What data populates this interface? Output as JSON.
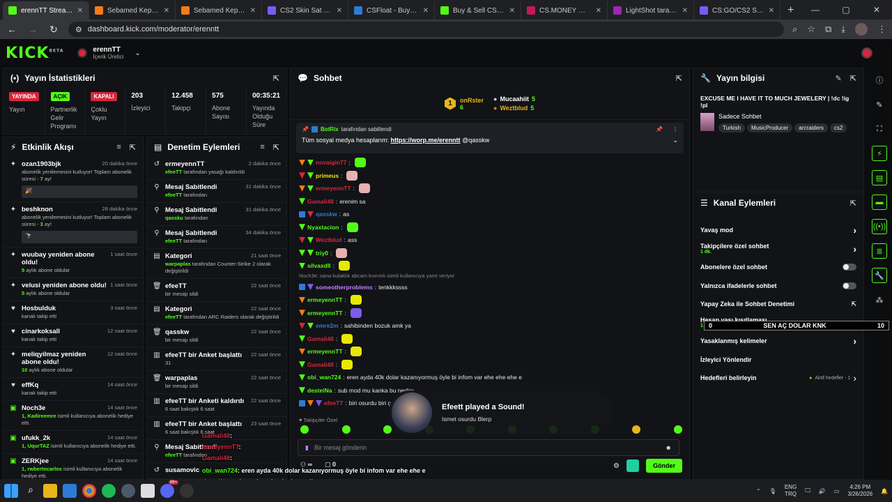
{
  "browser": {
    "tabs": [
      {
        "title": "erennTT Stream - Kick",
        "color": "#53fc18",
        "active": true
      },
      {
        "title": "Sebamed Kepek Karşıtı",
        "color": "#f57c18",
        "active": false
      },
      {
        "title": "Sebamed Kepeğe Karşı",
        "color": "#f57c18",
        "active": false
      },
      {
        "title": "CS2 Skin Sat - Anında",
        "color": "#7a5cf0",
        "active": false
      },
      {
        "title": "CSFloat - Buy & Sell C",
        "color": "#2e7bd6",
        "active": false
      },
      {
        "title": "Buy & Sell CSGO Skin",
        "color": "#53fc18",
        "active": false
      },
      {
        "title": "CS.MONEY — CS:GO",
        "color": "#c2185b",
        "active": false
      },
      {
        "title": "LightShot tarafından",
        "color": "#9c27b0",
        "active": false
      },
      {
        "title": "CS:GO/CS2 Skin Satış",
        "color": "#7a5cf0",
        "active": false
      }
    ],
    "url": "dashboard.kick.com/moderator/erenntt"
  },
  "header": {
    "logo": "KICK",
    "logo_sup": "BETA",
    "channel_name": "erennTT",
    "channel_role": "İçerik Üretici"
  },
  "stats": {
    "title": "Yayın İstatistikleri",
    "items": [
      {
        "badge": "YAYINDA",
        "badge_type": "red",
        "label": "Yayın"
      },
      {
        "badge": "AÇIK",
        "badge_type": "green",
        "label": "Partnerlik Gelir Programı"
      },
      {
        "badge": "KAPALI",
        "badge_type": "red",
        "label": "Çoklu Yayın"
      },
      {
        "num": "203",
        "label": "İzleyici"
      },
      {
        "num": "12.458",
        "label": "Takipçi"
      },
      {
        "num": "575",
        "label": "Abone Sayısı"
      },
      {
        "num": "00:35:21",
        "label": "Yayında Olduğu Süre"
      }
    ]
  },
  "activity": {
    "title": "Etkinlik Akışı",
    "items": [
      {
        "icon": "✦",
        "name": "ozan1903bjk",
        "time": "20 dakika önce",
        "sub": "abonelik yenilemesini kutluyor! Toplam abonelik süresi - ",
        "hl": "7",
        "sub2": " ay!",
        "box": "🎉"
      },
      {
        "icon": "✦",
        "name": "beshknon",
        "time": "28 dakika önce",
        "sub": "abonelik yenilemesini kutluyor! Toplam abonelik süresi - ",
        "hl": "3",
        "sub2": " ay!",
        "box": "🔭"
      },
      {
        "icon": "✦",
        "name": "wuubay yeniden abone oldu!",
        "time": "1 saat önce",
        "sub": "",
        "hl": "5",
        "sub2": " aylık abone oldular"
      },
      {
        "icon": "✦",
        "name": "velusi yeniden abone oldu!",
        "time": "1 saat önce",
        "sub": "",
        "hl": "5",
        "sub2": " aylık abone oldular"
      },
      {
        "icon": "♥",
        "name": "Hosbulduk",
        "time": "3 saat önce",
        "sub": "kanalı takip etti",
        "hl": "",
        "sub2": ""
      },
      {
        "icon": "♥",
        "name": "cinarkoksall",
        "time": "12 saat önce",
        "sub": "kanalı takip etti",
        "hl": "",
        "sub2": ""
      },
      {
        "icon": "✦",
        "name": "meliqyilmaz yeniden abone oldu!",
        "time": "12 saat önce",
        "sub": "",
        "hl": "10",
        "sub2": " aylık abone oldular"
      },
      {
        "icon": "♥",
        "name": "effKq",
        "time": "14 saat önce",
        "sub": "kanalı takip etti",
        "hl": "",
        "sub2": ""
      },
      {
        "icon": "▣",
        "name": "Noch3e",
        "time": "14 saat önce",
        "sub": "",
        "hl": "1, Kadireemre",
        "sub2": " isimli kullanıcıya abonelik hediye etti."
      },
      {
        "icon": "▣",
        "name": "ufukk_2k",
        "time": "14 saat önce",
        "sub": "",
        "hl": "1, UqurTAZ",
        "sub2": " isimli kullanıcıya abonelik hediye etti."
      },
      {
        "icon": "▣",
        "name": "ZERKjee",
        "time": "14 saat önce",
        "sub": "",
        "hl": "1, rwbertocarlos",
        "sub2": " isimli kullanıcıya abonelik hediye etti."
      }
    ]
  },
  "moderation": {
    "title": "Denetim Eylemleri",
    "items": [
      {
        "icon": "↺",
        "name": "ermeyennTT",
        "time": "2 dakika önce",
        "hl": "efeeTT",
        "sub": " tarafından yasağı kaldırıldı"
      },
      {
        "icon": "⚲",
        "name": "Mesaj Sabitlendi",
        "time": "31 dakika önce",
        "hl": "efeeTT",
        "sub": " tarafından"
      },
      {
        "icon": "⚲",
        "name": "Mesaj Sabitlendi",
        "time": "31 dakika önce",
        "hl": "qassku",
        "sub": " tarafından"
      },
      {
        "icon": "⚲",
        "name": "Mesaj Sabitlendi",
        "time": "34 dakika önce",
        "hl": "efeeTT",
        "sub": " tarafından"
      },
      {
        "icon": "▤",
        "name": "Kategori",
        "time": "21 saat önce",
        "hl": "warpaplas",
        "sub": " tarafından Counter-Strike 2 olarak değiştirildi"
      },
      {
        "icon": "🗑",
        "name": "efeeTT",
        "time": "22 saat önce",
        "hl": "",
        "sub": "bir mesajı sildi"
      },
      {
        "icon": "▤",
        "name": "Kategori",
        "time": "22 saat önce",
        "hl": "efeeTT",
        "sub": " tarafından ARC Raiders olarak değiştirildi"
      },
      {
        "icon": "🗑",
        "name": "qasskw",
        "time": "22 saat önce",
        "hl": "",
        "sub": "bir mesajı sildi"
      },
      {
        "icon": "▥",
        "name": "efeeTT bir Anket başlattı",
        "time": "22 saat önce",
        "hl": "",
        "sub": "31"
      },
      {
        "icon": "🗑",
        "name": "warpaplas",
        "time": "22 saat önce",
        "hl": "",
        "sub": "bir mesajı sildi"
      },
      {
        "icon": "▥",
        "name": "efeeTT bir Anketi kaldırdı",
        "time": "22 saat önce",
        "hl": "",
        "sub": "6 saat bakıştık 6 saat"
      },
      {
        "icon": "▥",
        "name": "efeeTT bir Anket başlattı",
        "time": "23 saat önce",
        "hl": "",
        "sub": "6 saat bakıştık 6 saat"
      },
      {
        "icon": "⚲",
        "name": "Mesaj Sabitlendi",
        "time": "",
        "hl": "efeeTT",
        "sub": " tarafından"
      },
      {
        "icon": "↺",
        "name": "susamovic",
        "time": "",
        "hl": "",
        "sub": ""
      }
    ]
  },
  "chat": {
    "title": "Sohbet",
    "top1": {
      "rank": "1",
      "name": "onRster",
      "count": "6"
    },
    "top2": {
      "name": "Mucaahiit",
      "count": "5"
    },
    "top3": {
      "name": "Weztblud",
      "count": "5"
    },
    "pinned_by": "BotRix",
    "pinned_suffix": "tarafından sabitlendi",
    "pinned_text": "Tüm sosyal medya hesaplarım: ",
    "pinned_link": "https://worp.me/erenntt",
    "pinned_mention": " @qasskw",
    "messages": [
      {
        "badges": [
          "o",
          "g"
        ],
        "nick": "novaigin77",
        "color": "#d7263d",
        "text": "",
        "emo": "#53fc18"
      },
      {
        "badges": [
          "r",
          "g"
        ],
        "nick": "primeus",
        "color": "#e8e800",
        "text": "",
        "emo": "#e8b1b1"
      },
      {
        "badges": [
          "o",
          "g"
        ],
        "nick": "ermeyennTT",
        "color": "#d7263d",
        "text": "",
        "emo": "#e8b1b1"
      },
      {
        "badges": [
          "g"
        ],
        "nick": "Gamali48",
        "color": "#d7263d",
        "text": "erenim sa",
        "emo": ""
      },
      {
        "badges": [
          "bl",
          "r"
        ],
        "nick": "qasskw",
        "color": "#2e7bd6",
        "text": "as",
        "emo": ""
      },
      {
        "badges": [
          "g"
        ],
        "nick": "Nyaxtacion",
        "color": "#53fc18",
        "text": "",
        "emo": "#53fc18"
      },
      {
        "badges": [
          "r",
          "g"
        ],
        "nick": "Weztblud",
        "color": "#d7263d",
        "text": "ass",
        "emo": ""
      },
      {
        "badges": [
          "g",
          "g"
        ],
        "nick": "triy0",
        "color": "#53fc18",
        "text": "",
        "emo": "#e8b1b1"
      },
      {
        "badges": [
          "g"
        ],
        "nick": "silvaxdll",
        "color": "#53fc18",
        "text": "",
        "emo": "#e8e800"
      }
    ],
    "reply_hint": "Noch3e: sana kulaklık abcam kıvrımlı isimli kullanıcıya yanıt veriyor",
    "messages2": [
      {
        "badges": [
          "bl",
          "pu"
        ],
        "nick": "someotherproblems",
        "color": "#c77dff",
        "text": "tenkkkssss",
        "emo": ""
      },
      {
        "badges": [
          "o"
        ],
        "nick": "ermeyennTT",
        "color": "#53fc18",
        "text": "",
        "emo": "#e8e800"
      },
      {
        "badges": [
          "o"
        ],
        "nick": "ermeyennTT",
        "color": "#53fc18",
        "text": "",
        "emo": "#7a5cf0"
      },
      {
        "badges": [
          "r",
          "g"
        ],
        "nick": "emre2m",
        "color": "#2e7bd6",
        "text": "sahibinden bozuk amk ya",
        "emo": ""
      },
      {
        "badges": [
          "g"
        ],
        "nick": "Gamali48",
        "color": "#d7263d",
        "text": "",
        "emo": "#e8e800"
      },
      {
        "badges": [
          "o"
        ],
        "nick": "ermeyennTT",
        "color": "#53fc18",
        "text": "",
        "emo": "#e8e800"
      },
      {
        "badges": [
          "g"
        ],
        "nick": "Gamali48",
        "color": "#d7263d",
        "text": "",
        "emo": "#e8e800"
      },
      {
        "badges": [
          "g"
        ],
        "nick": "obi_wan724",
        "color": "#53fc18",
        "text": "eren ayda 40k dolar kazanıyormuş öyle bi infom var ehe ehe ehe e",
        "emo": ""
      },
      {
        "badges": [
          "g"
        ],
        "nick": "desteiNa",
        "color": "#53fc18",
        "text": "sub mod mu kanka bu nedirs",
        "emo": ""
      },
      {
        "badges": [
          "bl",
          "o",
          "pu"
        ],
        "nick": "efeeTT",
        "color": "#d7263d",
        "text": "biri osurdu biri çok",
        "emo": ""
      }
    ],
    "followers_only_label": "Takipçiler Özel",
    "input_placeholder": "Bir mesaj gönderin",
    "count_a": "∞",
    "count_b": "0",
    "send_label": "Gönder"
  },
  "sound_popup": {
    "title": "Efeett played a Sound!",
    "sub": "Ismet osurdu Blerp"
  },
  "stream_info": {
    "title": "Yayın bilgisi",
    "stream_title": "EXCUSE ME I HAVE IT TO MUCH JEWELERY | !dc !ig !pl",
    "category": "Sadece Sohbet",
    "tags": [
      "Turkish",
      "MusicProducer",
      "arcraiders",
      "cs2"
    ]
  },
  "channel_actions": {
    "title": "Kanal Eylemleri",
    "rows": [
      {
        "label": "Yavaş mod",
        "control": "chevron"
      },
      {
        "label": "Takipçilere özel sohbet",
        "sub": "1 dk.",
        "control": "chevron"
      },
      {
        "label": "Abonelere özel sohbet",
        "control": "toggle"
      },
      {
        "label": "Yalnızca ifadelerle sohbet",
        "control": "toggle"
      },
      {
        "label": "Yapay Zeka ile Sohbet Denetimi",
        "control": "external"
      },
      {
        "label": "Hesap yaşı kısıtlaması",
        "sub": "1 dk.",
        "control": "chevron"
      },
      {
        "label": "Yasaklanmış kelimeler",
        "control": "chevron"
      },
      {
        "label": "İzleyici Yönlendir",
        "control": "none"
      },
      {
        "label": "Hedefleri belirleyin",
        "control": "goal",
        "goal_text": "Aktif hedefler - 1"
      }
    ]
  },
  "ticker": {
    "left": "0",
    "text": "SEN AÇ DOLAR KNK",
    "right": "10"
  },
  "overlay_chat": [
    {
      "nick": "Gamali48",
      "text": ":"
    },
    {
      "nick": "ermeyennTT",
      "text": ":"
    },
    {
      "nick": "Gamali48",
      "text": ":"
    },
    {
      "nick": "obi_wan724",
      "text": ": eren ayda 40k dolar kazanıyormuş öyle bi infom var ehe ehe e"
    },
    {
      "nick": "desteiNa",
      "text": ": sub mod mu kanka bu nedirs"
    },
    {
      "nick": "efeeTT",
      "text": ": biri osurdu biri çok kötü osurdu"
    }
  ],
  "taskbar": {
    "lang1": "ENG",
    "lang2": "TRQ",
    "time": "4:26 PM",
    "date": "3/26/2026",
    "notif_badge": "99+"
  }
}
